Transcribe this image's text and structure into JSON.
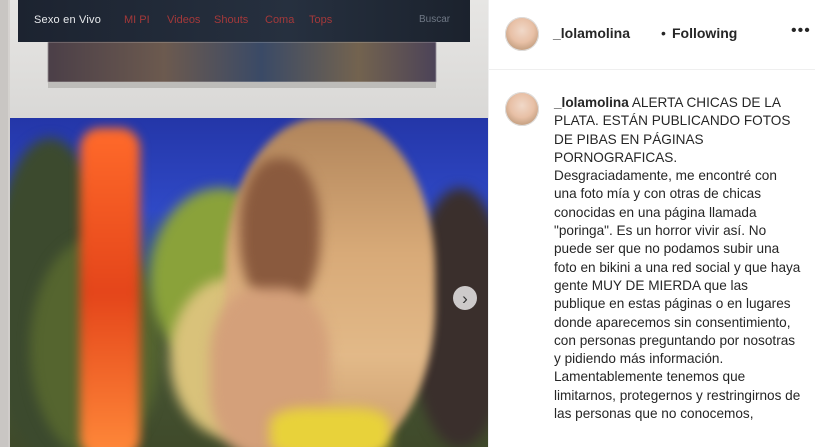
{
  "photo": {
    "site_brand": "Sexo en Vivo",
    "nav_items": [
      "MI PI",
      "Videos",
      "Shouts",
      "Coma",
      "Tops"
    ],
    "search_label": "Buscar"
  },
  "header": {
    "username": "_lolamolina",
    "separator": "•",
    "follow_status": "Following",
    "more_icon": "more-options-icon"
  },
  "caption": {
    "username": "_lolamolina",
    "lines": [
      "ALERTA CHICAS DE LA PLATA. ESTÁN PUBLICANDO FOTOS DE PIBAS EN PÁGINAS PORNOGRAFICAS.",
      "Desgraciadamente, me encontré con una foto mía y con otras de chicas conocidas en una página llamada \"poringa\". Es un horror vivir así. No puede ser que no podamos subir una foto en bikini a una red social y que haya gente MUY DE MIERDA que las publique en estas páginas o en lugares donde aparecemos sin consentimiento, con personas preguntando por nosotras y pidiendo más información.",
      "Lamentablemente tenemos que limitarnos, protegernos y restringirnos de las personas que no conocemos,"
    ]
  },
  "icons": {
    "next": "chevron-right-icon"
  }
}
